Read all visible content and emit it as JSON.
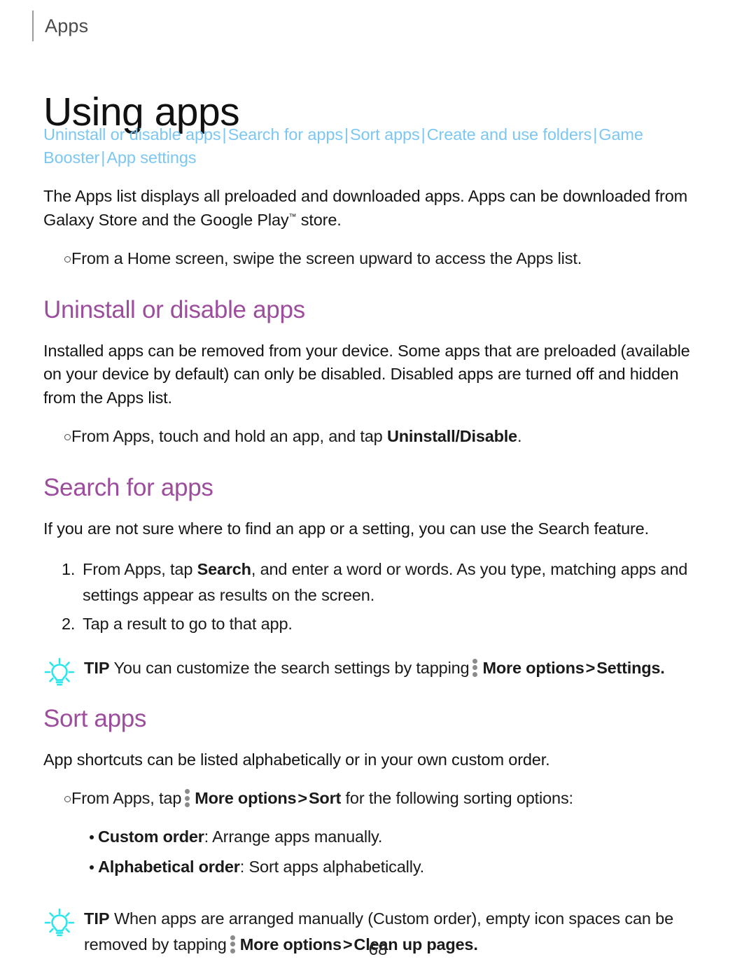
{
  "header": {
    "running_head": "Apps"
  },
  "page_title": "Using apps",
  "nav_links": {
    "separator": "|",
    "items": [
      "Uninstall or disable apps",
      "Search for apps",
      "Sort apps",
      "Create and use folders",
      "Game Booster",
      "App settings"
    ]
  },
  "intro": {
    "paragraph_part1": "The Apps list displays all preloaded and downloaded apps. Apps can be downloaded from Galaxy Store and the Google Play",
    "trademark": "™",
    "paragraph_part2": " store.",
    "bullet": "From a Home screen, swipe the screen upward to access the Apps list."
  },
  "sections": [
    {
      "heading": "Uninstall or disable apps",
      "paragraph": "Installed apps can be removed from your device. Some apps that are preloaded (available on your device by default) can only be disabled. Disabled apps are turned off and hidden from the Apps list.",
      "bullet_prefix": "From Apps, touch and hold an app, and tap ",
      "bullet_bold": "Uninstall/Disable",
      "bullet_suffix": "."
    },
    {
      "heading": "Search for apps",
      "paragraph": "If you are not sure where to find an app or a setting, you can use the Search feature.",
      "steps": [
        {
          "number": "1.",
          "text_before_bold": "From Apps, tap ",
          "bold": "Search",
          "text_after_bold": ", and enter a word or words. As you type, matching apps and settings appear as results on the screen."
        },
        {
          "number": "2.",
          "text_before_bold": "Tap a result to go to that app.",
          "bold": "",
          "text_after_bold": ""
        }
      ],
      "tip": {
        "label": "TIP",
        "text_before_icon": "You can customize the search settings by tapping",
        "icon_name": "more-options-icon",
        "bold_item_1": "More options",
        "arrow": ">",
        "bold_item_2": "Settings",
        "text_after": "."
      }
    },
    {
      "heading": "Sort apps",
      "paragraph": "App shortcuts can be listed alphabetically or in your own custom order.",
      "bullet_prefix": "From Apps, tap",
      "bullet_bold_1": "More options",
      "bullet_arrow": ">",
      "bullet_bold_2": "Sort",
      "bullet_suffix": " for the following sorting options:",
      "options": [
        {
          "term": "Custom order",
          "separator": ":",
          "definition": " Arrange apps manually."
        },
        {
          "term": "Alphabetical order",
          "separator": ":",
          "definition": " Sort apps alphabetically."
        }
      ],
      "tip": {
        "label": "TIP",
        "line1": "When apps are arranged manually (Custom order), empty icon spaces",
        "line2_before_icon": "can be removed by tapping",
        "icon_name": "more-options-icon",
        "bold_item_1": "More options",
        "arrow": ">",
        "bold_item_2": "Clean up pages",
        "text_after": "."
      }
    }
  ],
  "footer": {
    "page_number": "68"
  },
  "colors": {
    "heading_purple": "#9c4d9c",
    "link_blue": "#7cc7f2",
    "tip_bulb_cyan": "#2ae6ea",
    "kebab_gray": "#8b8b8b",
    "body_text": "#141414"
  }
}
